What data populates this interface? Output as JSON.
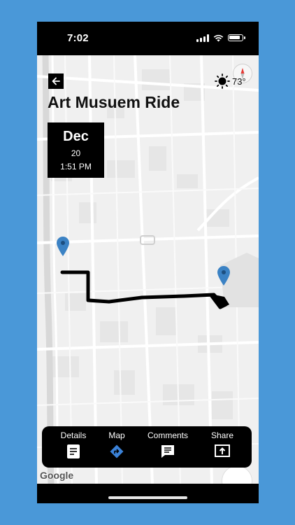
{
  "status_bar": {
    "time": "7:02"
  },
  "header": {
    "title": "Art Musuem Ride",
    "back_icon": "arrow-left-icon"
  },
  "weather": {
    "icon": "sun-icon",
    "temperature": "73°"
  },
  "date_card": {
    "month": "Dec",
    "day": "20",
    "time": "1:51 PM"
  },
  "bottom_nav": {
    "items": [
      {
        "label": "Details",
        "icon": "document-icon"
      },
      {
        "label": "Map",
        "icon": "directions-icon",
        "active_color": "#3b82d8"
      },
      {
        "label": "Comments",
        "icon": "comment-icon"
      },
      {
        "label": "Share",
        "icon": "share-icon"
      }
    ]
  },
  "map": {
    "attribution": "Google",
    "route_color": "#000000",
    "pin_color": "#3b82c4"
  }
}
